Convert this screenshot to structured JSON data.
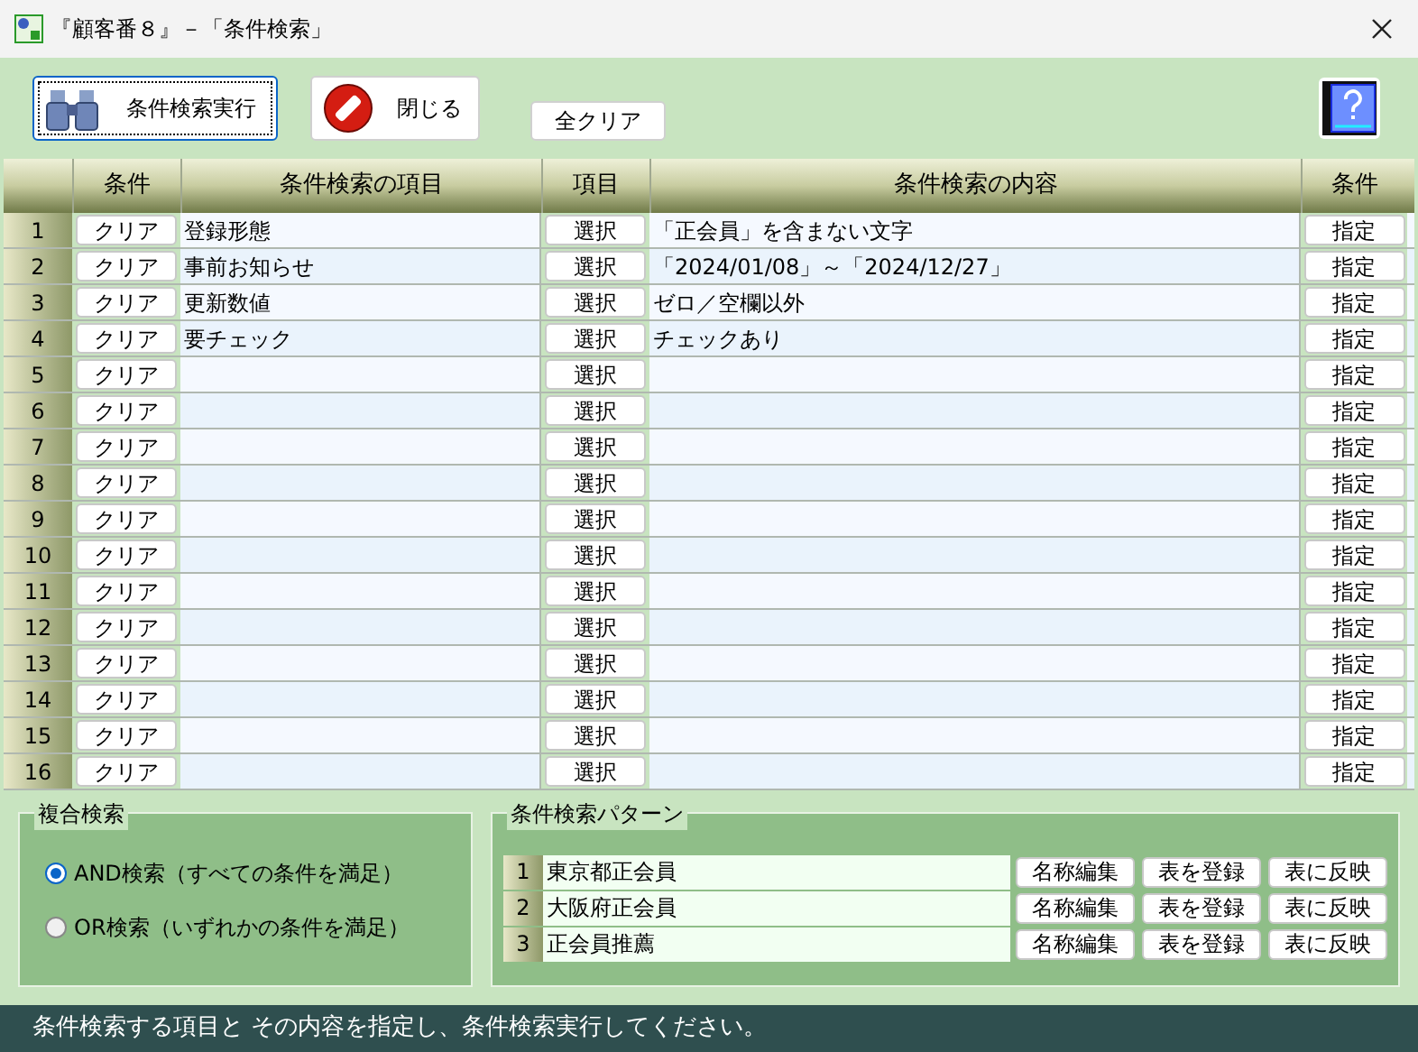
{
  "window": {
    "title": "『顧客番８』－「条件検索」"
  },
  "toolbar": {
    "buttons": [
      {
        "kind": "search",
        "label": "条件検索実行",
        "focused": true
      },
      {
        "kind": "close",
        "label": "閉じる",
        "focused": false
      },
      {
        "kind": "plain",
        "label": "全クリア",
        "focused": false
      }
    ]
  },
  "table": {
    "columns": [
      "条件",
      "条件検索の項目",
      "項目",
      "条件検索の内容",
      "条件"
    ],
    "rows": [
      {
        "number": "1",
        "clear": "クリア",
        "item": "登録形態",
        "select": "選択",
        "content": "「正会員」を含まない文字",
        "assign": "指定"
      },
      {
        "number": "2",
        "clear": "クリア",
        "item": "事前お知らせ",
        "select": "選択",
        "content": "「2024/01/08」～「2024/12/27」",
        "assign": "指定"
      },
      {
        "number": "3",
        "clear": "クリア",
        "item": "更新数値",
        "select": "選択",
        "content": "ゼロ／空欄以外",
        "assign": "指定"
      },
      {
        "number": "4",
        "clear": "クリア",
        "item": "要チェック",
        "select": "選択",
        "content": "チェックあり",
        "assign": "指定"
      },
      {
        "number": "5",
        "clear": "クリア",
        "select": "選択",
        "assign": "指定"
      },
      {
        "number": "6",
        "clear": "クリア",
        "select": "選択",
        "assign": "指定"
      },
      {
        "number": "7",
        "clear": "クリア",
        "select": "選択",
        "assign": "指定"
      },
      {
        "number": "8",
        "clear": "クリア",
        "select": "選択",
        "assign": "指定"
      },
      {
        "number": "9",
        "clear": "クリア",
        "select": "選択",
        "assign": "指定"
      },
      {
        "number": "10",
        "clear": "クリア",
        "select": "選択",
        "assign": "指定"
      },
      {
        "number": "11",
        "clear": "クリア",
        "select": "選択",
        "assign": "指定"
      },
      {
        "number": "12",
        "clear": "クリア",
        "select": "選択",
        "assign": "指定"
      },
      {
        "number": "13",
        "clear": "クリア",
        "select": "選択",
        "assign": "指定"
      },
      {
        "number": "14",
        "clear": "クリア",
        "select": "選択",
        "assign": "指定"
      },
      {
        "number": "15",
        "clear": "クリア",
        "select": "選択",
        "assign": "指定"
      },
      {
        "number": "16",
        "clear": "クリア",
        "select": "選択",
        "assign": "指定"
      }
    ]
  },
  "combined_search": {
    "title": "複合検索",
    "options": [
      {
        "label": "AND検索（すべての条件を満足）",
        "selected": true
      },
      {
        "label": "OR検索（いずれかの条件を満足）",
        "selected": false
      }
    ]
  },
  "patterns": {
    "title": "条件検索パターン",
    "rows": [
      {
        "number": "1",
        "name": "東京都正会員",
        "buttons": [
          "名称編集",
          "表を登録",
          "表に反映"
        ]
      },
      {
        "number": "2",
        "name": "大阪府正会員",
        "buttons": [
          "名称編集",
          "表を登録",
          "表に反映"
        ]
      },
      {
        "number": "3",
        "name": "正会員推薦",
        "buttons": [
          "名称編集",
          "表を登録",
          "表に反映"
        ]
      }
    ]
  },
  "status_bar": "条件検索する項目と その内容を指定し、条件検索実行してください。"
}
